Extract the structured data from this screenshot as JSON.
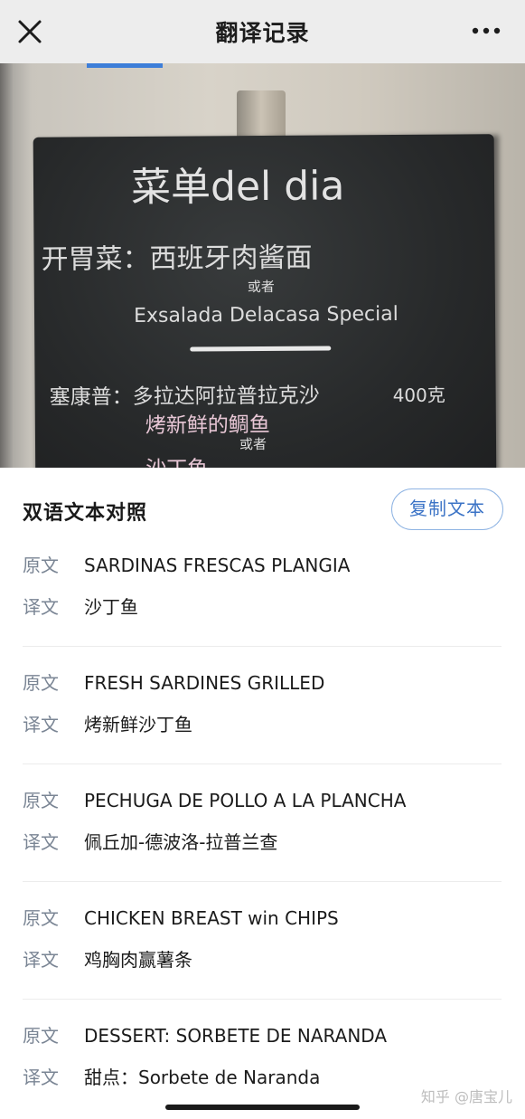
{
  "header": {
    "title": "翻译记录",
    "close_icon": "close-icon",
    "more_icon": "more-dots-icon"
  },
  "photo": {
    "board_title": "菜单del dia",
    "line1": "开胃菜：西班牙肉酱面",
    "or1": "或者",
    "line2": "Exsalada Delacasa Special",
    "line3": "塞康普：多拉达阿拉普拉克沙",
    "line3_price": "400克",
    "line4": "烤新鲜的鲷鱼",
    "or2": "或者",
    "line5": "沙丁鱼"
  },
  "sheet": {
    "title": "双语文本对照",
    "copy_label": "复制文本",
    "orig_label": "原文",
    "trans_label": "译文",
    "entries": [
      {
        "original": "SARDINAS FRESCAS PLANGIA",
        "translation": "沙丁鱼"
      },
      {
        "original": "FRESH SARDINES GRILLED",
        "translation": "烤新鲜沙丁鱼"
      },
      {
        "original": "PECHUGA DE POLLO A LA PLANCHA",
        "translation": "佩丘加-德波洛-拉普兰查"
      },
      {
        "original": "CHICKEN BREAST win CHIPS",
        "translation": "鸡胸肉赢薯条"
      },
      {
        "original": "DESSERT: SORBETE DE NARANDA",
        "translation": "甜点：Sorbete de Naranda"
      }
    ]
  },
  "watermark": "知乎 @唐宝儿",
  "colors": {
    "accent": "#3b73c6",
    "label_gray": "#7a8594",
    "topbar_bg": "#ededed"
  }
}
